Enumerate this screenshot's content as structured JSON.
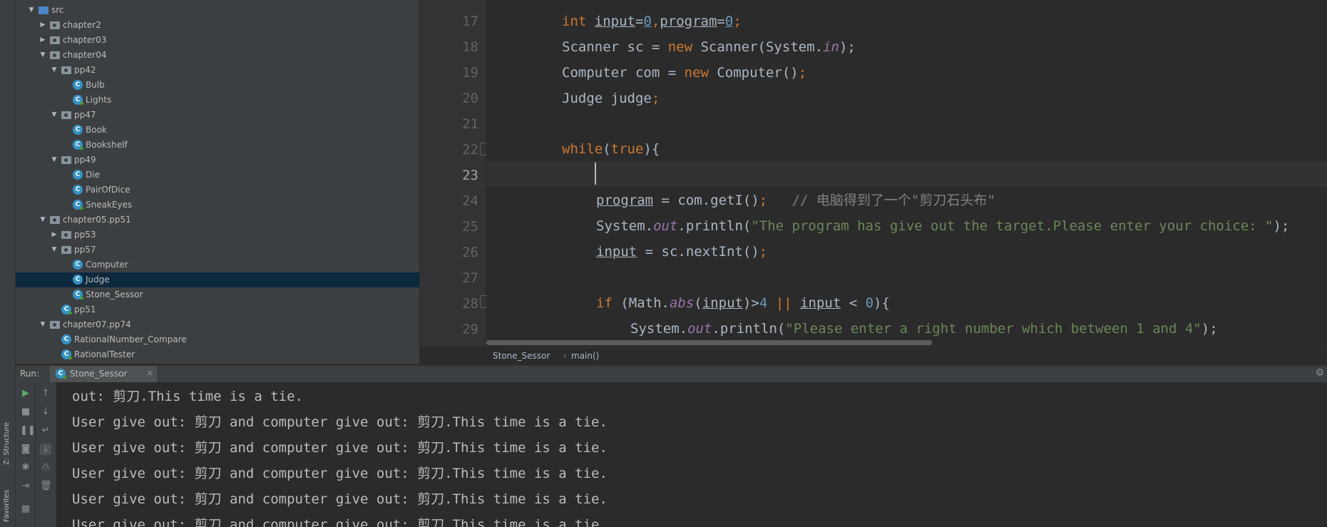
{
  "project_tree": [
    {
      "label": "src",
      "depth": 0,
      "type": "src-folder",
      "expanded": true
    },
    {
      "label": "chapter2",
      "depth": 1,
      "type": "package",
      "expanded": false
    },
    {
      "label": "chapter03",
      "depth": 1,
      "type": "package",
      "expanded": false
    },
    {
      "label": "chapter04",
      "depth": 1,
      "type": "package",
      "expanded": true
    },
    {
      "label": "pp42",
      "depth": 2,
      "type": "package",
      "expanded": true
    },
    {
      "label": "Bulb",
      "depth": 3,
      "type": "class"
    },
    {
      "label": "Lights",
      "depth": 3,
      "type": "main-class"
    },
    {
      "label": "pp47",
      "depth": 2,
      "type": "package",
      "expanded": true
    },
    {
      "label": "Book",
      "depth": 3,
      "type": "class"
    },
    {
      "label": "Bookshelf",
      "depth": 3,
      "type": "main-class"
    },
    {
      "label": "pp49",
      "depth": 2,
      "type": "package",
      "expanded": true
    },
    {
      "label": "Die",
      "depth": 3,
      "type": "class"
    },
    {
      "label": "PairOfDice",
      "depth": 3,
      "type": "class"
    },
    {
      "label": "SneakEyes",
      "depth": 3,
      "type": "main-class"
    },
    {
      "label": "chapter05.pp51",
      "depth": 1,
      "type": "package",
      "expanded": true
    },
    {
      "label": "pp53",
      "depth": 2,
      "type": "package",
      "expanded": false
    },
    {
      "label": "pp57",
      "depth": 2,
      "type": "package",
      "expanded": true
    },
    {
      "label": "Computer",
      "depth": 3,
      "type": "class"
    },
    {
      "label": "Judge",
      "depth": 3,
      "type": "class",
      "selected": true
    },
    {
      "label": "Stone_Sessor",
      "depth": 3,
      "type": "main-class"
    },
    {
      "label": "pp51",
      "depth": 2,
      "type": "main-class"
    },
    {
      "label": "chapter07.pp74",
      "depth": 1,
      "type": "package",
      "expanded": true
    },
    {
      "label": "RationalNumber_Compare",
      "depth": 2,
      "type": "class"
    },
    {
      "label": "RationalTester",
      "depth": 2,
      "type": "main-class"
    }
  ],
  "editor": {
    "line_numbers": [
      "17",
      "18",
      "19",
      "20",
      "21",
      "22",
      "23",
      "24",
      "25",
      "26",
      "27",
      "28",
      "29"
    ],
    "current_line": "23",
    "code": {
      "l17_int": "int",
      "l17_input": "input",
      "l17_eq1": "=",
      "l17_z1": "0",
      "l17_comma": ",",
      "l17_program": "program",
      "l17_eq2": "=",
      "l17_z2": "0",
      "l17_semi": ";",
      "l18_a": "Scanner sc = ",
      "l18_new": "new",
      "l18_b": " Scanner(System.",
      "l18_in": "in",
      "l18_c": ");",
      "l19_a": "Computer com = ",
      "l19_new": "new",
      "l19_b": " Computer()",
      "l19_semi": ";",
      "l20_a": "Judge judge",
      "l20_semi": ";",
      "l22_while": "while",
      "l22_paren1": "(",
      "l22_true": "true",
      "l22_rest": "){",
      "l24_program": "program",
      "l24_b": " = com.getI()",
      "l24_semi": ";",
      "l24_cmt": "   // 电脑得到了一个\"剪刀石头布\"",
      "l25_a": "System.",
      "l25_out": "out",
      "l25_b": ".println(",
      "l25_str": "\"The program has give out the target.Please enter your choice: \"",
      "l25_c": ");",
      "l26_input": "input",
      "l26_b": " = sc.nextInt()",
      "l26_semi": ";",
      "l28_if": "if",
      "l28_a": " (Math.",
      "l28_abs": "abs",
      "l28_b": "(",
      "l28_input1": "input",
      "l28_c": ")>",
      "l28_four": "4",
      "l28_or": " || ",
      "l28_input2": "input",
      "l28_d": " < ",
      "l28_zero": "0",
      "l28_e": "){",
      "l29_a": "System.",
      "l29_out": "out",
      "l29_b": ".println(",
      "l29_str": "\"Please enter a right number which between 1 and 4\"",
      "l29_c": ");"
    }
  },
  "breadcrumb": [
    "Stone_Sessor",
    "main()"
  ],
  "run_panel": {
    "label": "Run:",
    "tab": "Stone_Sessor",
    "side_labels": [
      "Z: Structure",
      "Favorites"
    ],
    "console_lines": [
      "out: 剪刀.This time is a tie.",
      "User give out: 剪刀 and computer give out: 剪刀.This time is a tie.",
      "User give out: 剪刀 and computer give out: 剪刀.This time is a tie.",
      "User give out: 剪刀 and computer give out: 剪刀.This time is a tie.",
      "User give out: 剪刀 and computer give out: 剪刀.This time is a tie.",
      "User give out: 剪刀 and computer give out: 剪刀.This time is a tie."
    ]
  },
  "colors": {
    "keyword": "#cc7832",
    "number": "#6897bb",
    "string": "#6a8759",
    "comment": "#808080",
    "field": "#9876aa",
    "selection": "#0d293e"
  }
}
